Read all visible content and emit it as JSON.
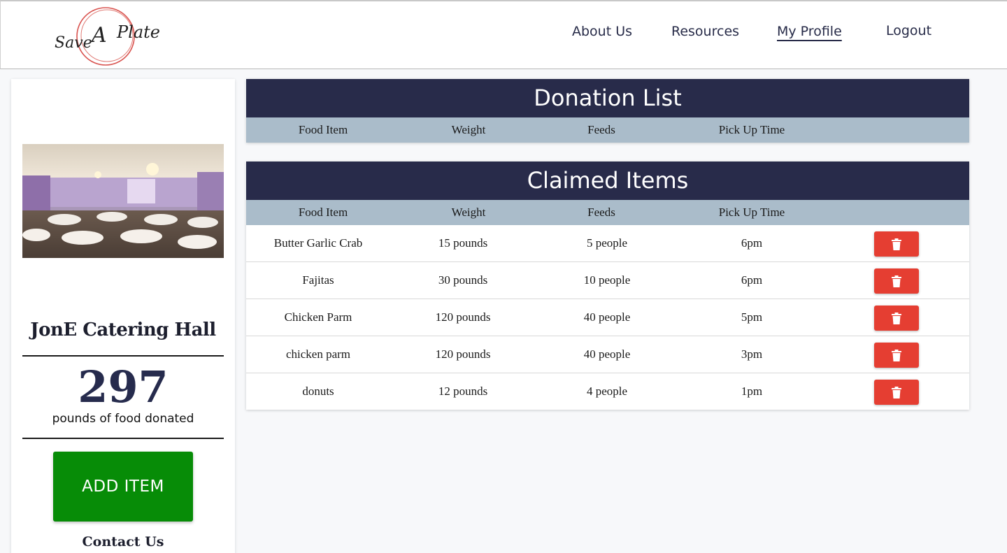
{
  "brand": {
    "logo_text": "Save A Plate"
  },
  "nav": {
    "about": "About Us",
    "resources": "Resources",
    "profile": "My Profile",
    "logout": "Logout"
  },
  "profile": {
    "name": "JonE Catering Hall",
    "pounds_donated": "297",
    "pounds_caption": "pounds of food donated",
    "add_item_label": "ADD ITEM",
    "contact_label": "Contact Us"
  },
  "donation_list": {
    "title": "Donation List",
    "columns": [
      "Food Item",
      "Weight",
      "Feeds",
      "Pick Up Time"
    ],
    "rows": []
  },
  "claimed_items": {
    "title": "Claimed Items",
    "columns": [
      "Food Item",
      "Weight",
      "Feeds",
      "Pick Up Time"
    ],
    "rows": [
      {
        "item": "Butter Garlic Crab",
        "weight": "15 pounds",
        "feeds": "5 people",
        "pickup": "6pm"
      },
      {
        "item": "Fajitas",
        "weight": "30 pounds",
        "feeds": "10 people",
        "pickup": "6pm"
      },
      {
        "item": "Chicken Parm",
        "weight": "120 pounds",
        "feeds": "40 people",
        "pickup": "5pm"
      },
      {
        "item": "chicken parm",
        "weight": "120 pounds",
        "feeds": "40 people",
        "pickup": "3pm"
      },
      {
        "item": "donuts",
        "weight": "12 pounds",
        "feeds": "4 people",
        "pickup": "1pm"
      }
    ],
    "delete_icon": "trash-icon"
  },
  "colors": {
    "header_navy": "#282b4a",
    "column_header": "#aabcca",
    "add_button": "#078c07",
    "delete_button": "#e53e32"
  }
}
